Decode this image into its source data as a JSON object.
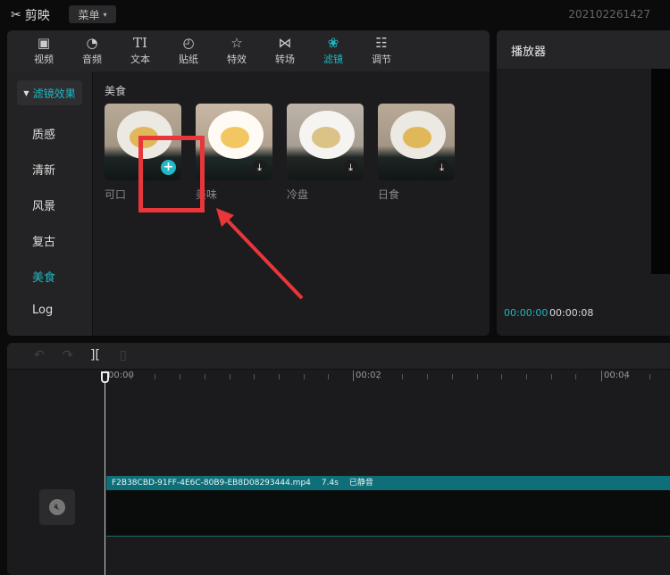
{
  "app": {
    "name": "剪映",
    "menu_label": "菜单",
    "project_name": "202102261427"
  },
  "tabs": [
    {
      "label": "视频",
      "icon": "video-icon"
    },
    {
      "label": "音频",
      "icon": "audio-icon"
    },
    {
      "label": "文本",
      "icon": "text-icon"
    },
    {
      "label": "贴纸",
      "icon": "sticker-icon"
    },
    {
      "label": "特效",
      "icon": "effects-icon"
    },
    {
      "label": "转场",
      "icon": "transition-icon"
    },
    {
      "label": "滤镜",
      "icon": "filter-icon",
      "active": true
    },
    {
      "label": "调节",
      "icon": "adjust-icon"
    }
  ],
  "sidebar": {
    "header": "滤镜效果",
    "items": [
      "质感",
      "清新",
      "风景",
      "复古",
      "美食",
      "Log"
    ],
    "active": "美食"
  },
  "section_title": "美食",
  "filters": [
    {
      "label": "可口",
      "action": "add"
    },
    {
      "label": "美味",
      "action": "download"
    },
    {
      "label": "冷盘",
      "action": "download"
    },
    {
      "label": "日食",
      "action": "download"
    }
  ],
  "player": {
    "title": "播放器",
    "current_time": "00:00:00",
    "total_time": "00:00:08"
  },
  "timeline": {
    "ruler": [
      "00:00",
      "00:02",
      "00:04"
    ],
    "clip": {
      "filename": "F2B38CBD-91FF-4E6C-80B9-EB8D08293444.mp4",
      "duration": "7.4s",
      "status": "已静音"
    }
  },
  "colors": {
    "accent": "#1fb6c1",
    "clip": "#0e6f78",
    "annotation": "#e8363a"
  }
}
